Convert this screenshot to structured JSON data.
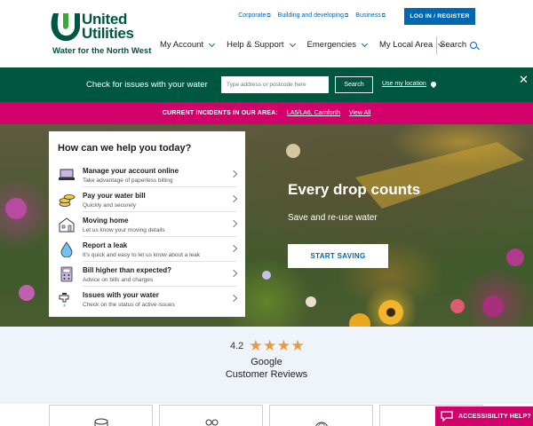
{
  "brand": {
    "name_line1": "United",
    "name_line2": "Utilities",
    "tagline": "Water for the North West",
    "primary_color": "#00573f",
    "accent_color": "#d3006b",
    "link_color": "#0067b1"
  },
  "utility_links": [
    {
      "label": "Corporate",
      "icon": "external-link-icon"
    },
    {
      "label": "Building and developing",
      "icon": "external-link-icon"
    },
    {
      "label": "Business",
      "icon": "external-link-icon"
    }
  ],
  "login_label": "LOG IN / REGISTER",
  "nav": {
    "items": [
      {
        "label": "My Account"
      },
      {
        "label": "Help & Support"
      },
      {
        "label": "Emergencies"
      },
      {
        "label": "My Local Area"
      }
    ],
    "search_label": "Search"
  },
  "check_bar": {
    "label": "Check for issues with your water",
    "placeholder": "Type address or postcode here",
    "button": "Search",
    "use_location": "Use my location",
    "close_icon": "close-icon"
  },
  "incidents": {
    "label": "CURRENT INCIDENTS IN OUR AREA:",
    "location": "LA5/LA6, Carnforth",
    "view_all": "View All"
  },
  "hero": {
    "title": "Every drop counts",
    "subtitle": "Save and re-use water",
    "cta": "START SAVING"
  },
  "help": {
    "title": "How can we help you today?",
    "items": [
      {
        "label": "Manage your account online",
        "desc": "Take advantage of paperless billing",
        "icon": "laptop-icon"
      },
      {
        "label": "Pay your water bill",
        "desc": "Quickly and securely",
        "icon": "coins-icon"
      },
      {
        "label": "Moving home",
        "desc": "Let us know your moving details",
        "icon": "house-icon"
      },
      {
        "label": "Report a leak",
        "desc": "It's quick and easy to let us know about a leak",
        "icon": "water-drop-icon"
      },
      {
        "label": "Bill higher than expected?",
        "desc": "Advice on bills and charges",
        "icon": "calculator-icon"
      },
      {
        "label": "Issues with your water",
        "desc": "Check on the status of active issues",
        "icon": "tap-icon"
      }
    ]
  },
  "reviews": {
    "rating": "4.2",
    "stars": 4,
    "line1": "Google",
    "line2": "Customer Reviews"
  },
  "accessibility_label": "ACCESSIBILITY HELP?"
}
